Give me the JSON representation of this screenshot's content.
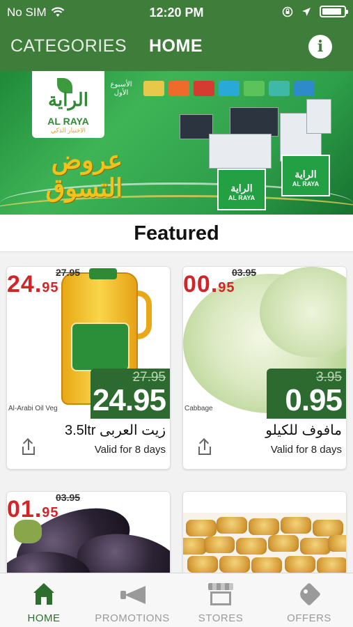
{
  "status_bar": {
    "carrier": "No SIM",
    "time": "12:20 PM"
  },
  "nav": {
    "categories_label": "CATEGORIES",
    "home_label": "HOME",
    "info_label": "i"
  },
  "banner": {
    "logo_arabic": "الراية",
    "logo_english": "AL RAYA",
    "logo_tagline": "الاختيار الذكي",
    "week_label": "الأسبوع الأول",
    "promo_line1": "عروض",
    "promo_line2": "التسوق",
    "gift_arabic": "الراية",
    "gift_english": "AL RAYA"
  },
  "section": {
    "title": "Featured"
  },
  "products": [
    {
      "title": "زيت العربى 3.5ltr",
      "validity": "Valid for 8 days",
      "old_price": "27.95",
      "new_price": "24.95",
      "image_price_main": "24.",
      "image_price_decimal": "95",
      "image_old_price": "27.95",
      "image_caption": "Al-Arabi Oil Veg"
    },
    {
      "title": "مافوف للكيلو",
      "validity": "Valid for 8 days",
      "old_price": "3.95",
      "new_price": "0.95",
      "image_price_main": "00.",
      "image_price_decimal": "95",
      "image_old_price": "03.95",
      "image_caption": "Cabbage"
    },
    {
      "image_price_main": "01.",
      "image_price_decimal": "95",
      "image_old_price": "03.95"
    },
    {}
  ],
  "tabbar": {
    "home": "HOME",
    "promotions": "PROMOTIONS",
    "stores": "STORES",
    "offers": "OFFERS"
  },
  "colors": {
    "brand_green": "#3e7d3a",
    "price_tag_green": "#2c6a2f",
    "price_red": "#d0262a",
    "active_tab": "#2f6d2f",
    "inactive_tab": "#9a9a9a"
  },
  "icons": [
    "wifi-icon",
    "lock-rotation-icon",
    "location-arrow-icon",
    "battery-icon",
    "info-icon",
    "share-icon",
    "home-icon",
    "megaphone-icon",
    "store-icon",
    "tag-icon"
  ]
}
